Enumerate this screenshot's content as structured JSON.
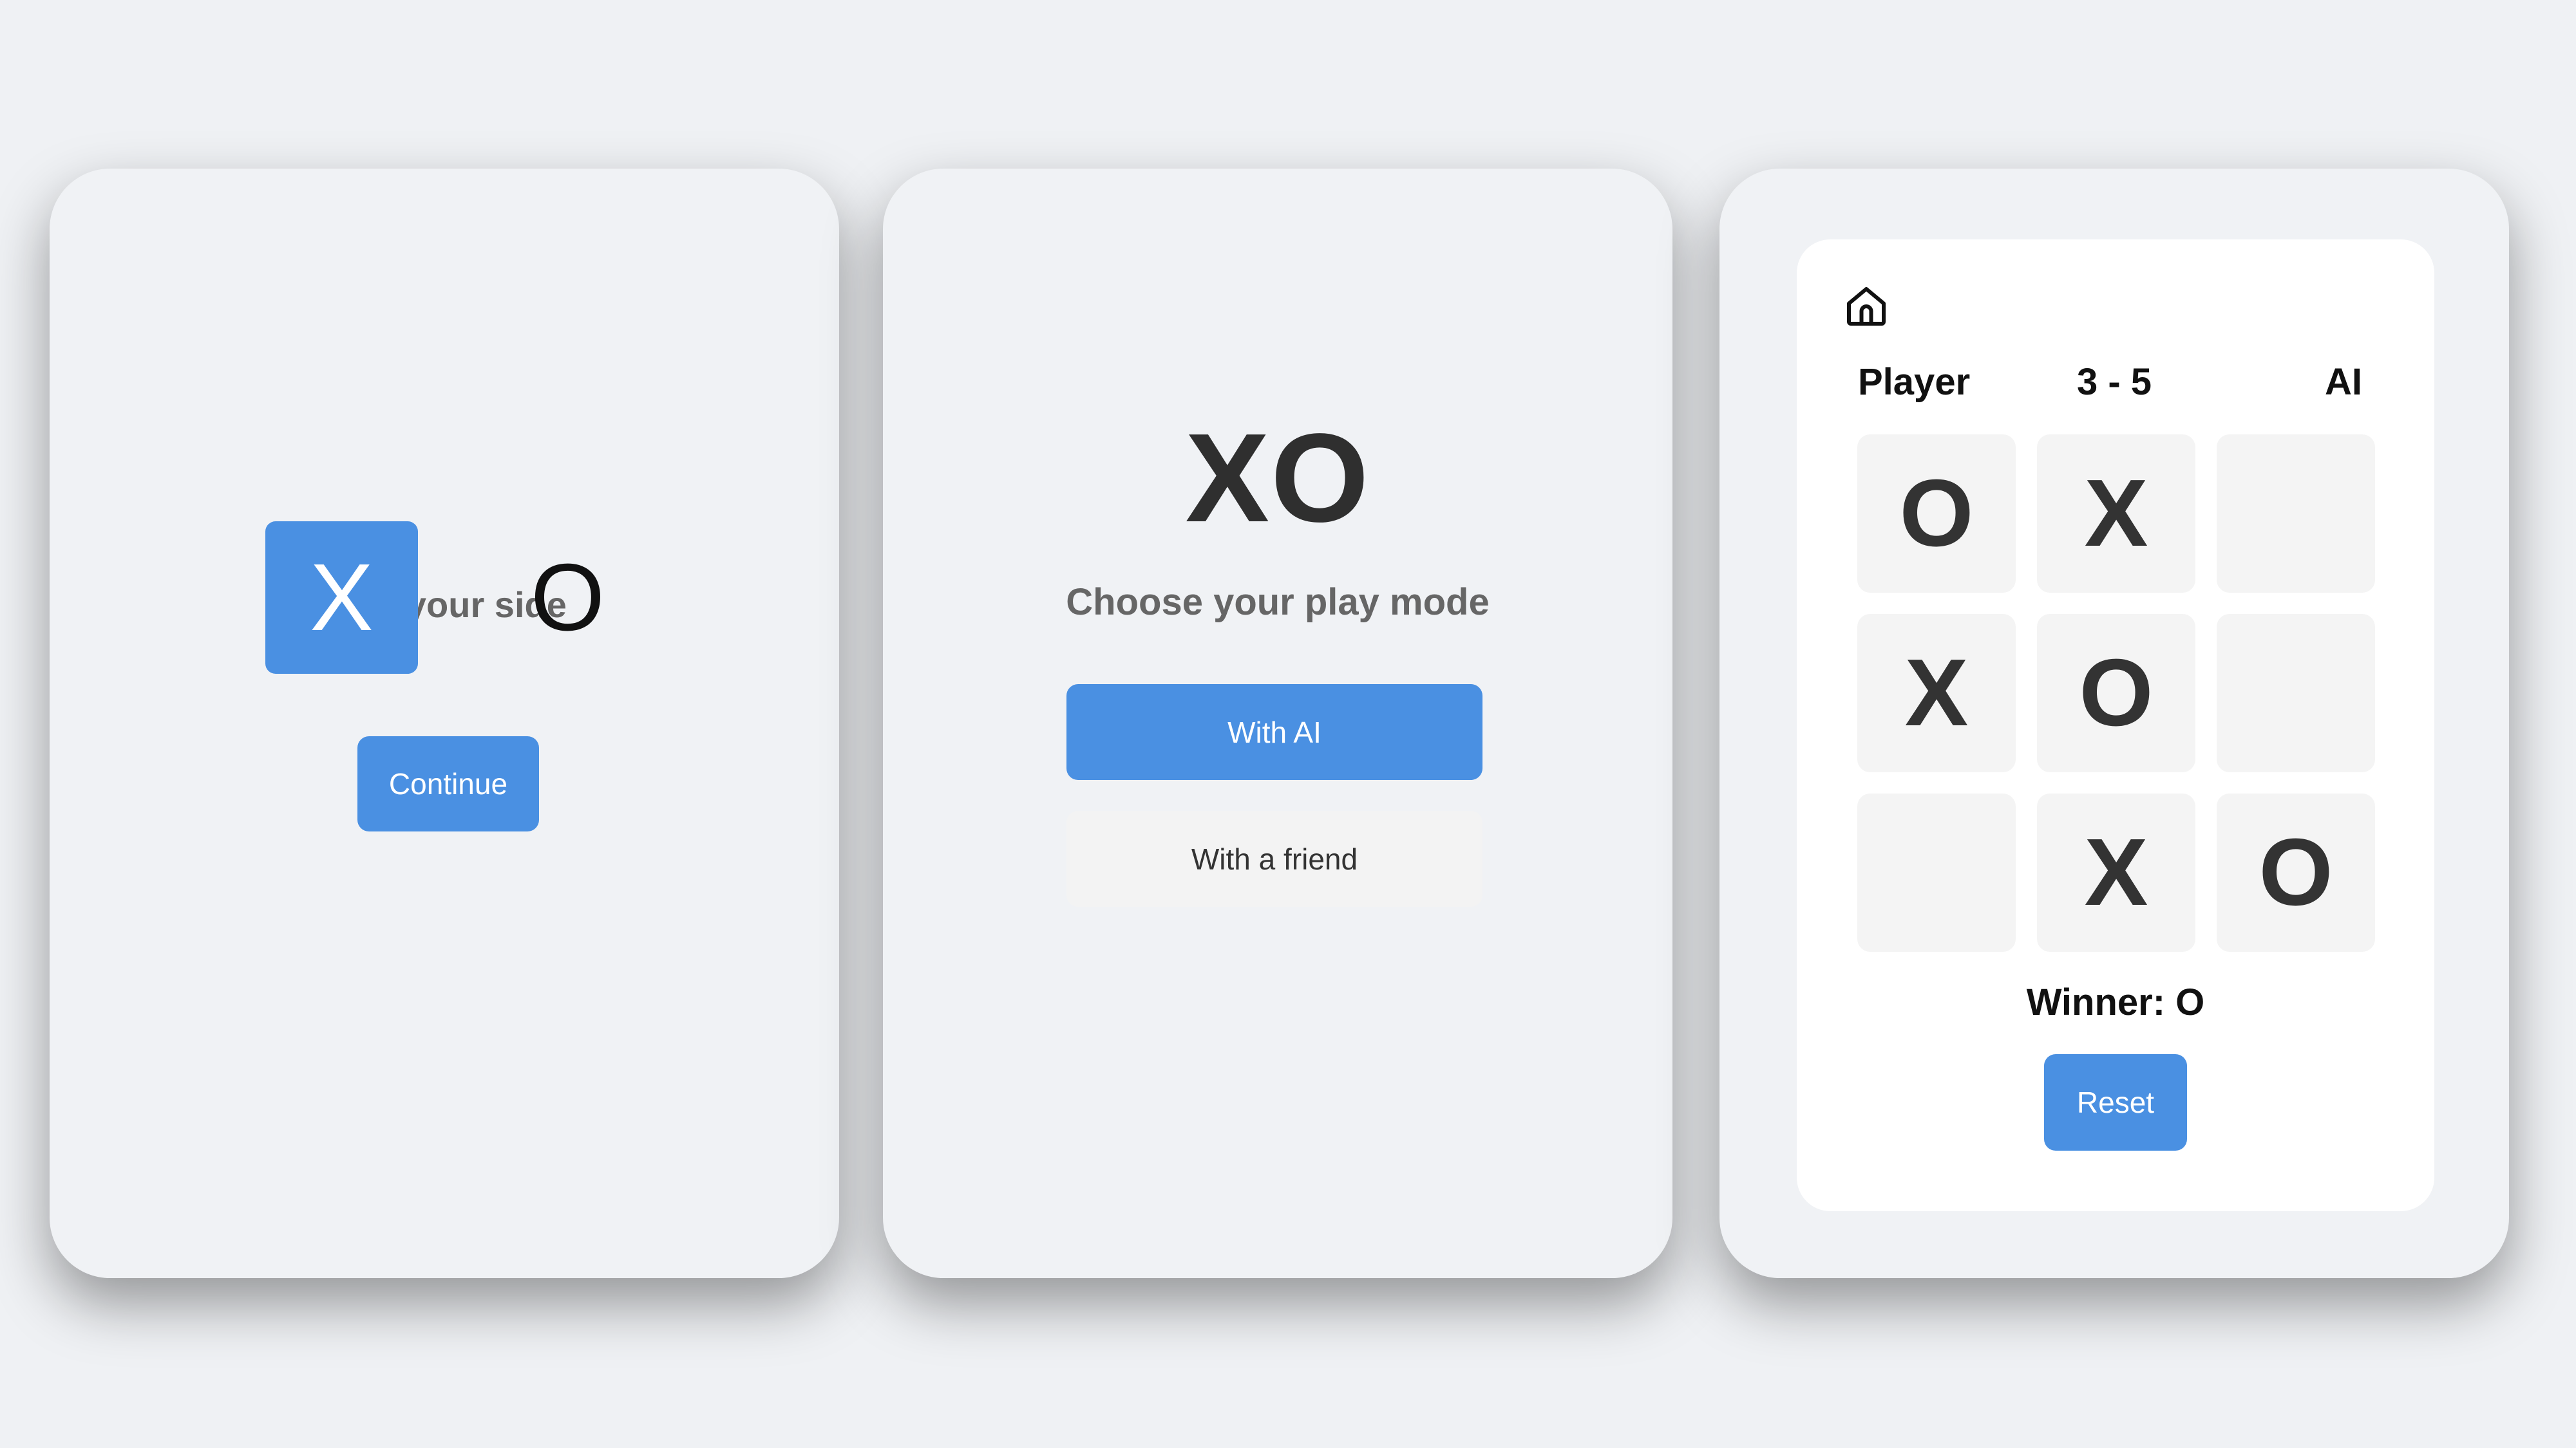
{
  "side_picker": {
    "title": "Pick your side",
    "options": [
      {
        "symbol": "X",
        "selected": true
      },
      {
        "symbol": "O",
        "selected": false
      }
    ],
    "continue_label": "Continue"
  },
  "mode_picker": {
    "logo": "XO",
    "subtitle": "Choose your play mode",
    "ai_label": "With AI",
    "friend_label": "With a friend"
  },
  "game": {
    "home_icon": "home-icon",
    "player_label": "Player",
    "score": "3 - 5",
    "opponent_label": "AI",
    "board": [
      "O",
      "X",
      "",
      "X",
      "O",
      "",
      "",
      "X",
      "O"
    ],
    "winner_text": "Winner: O",
    "reset_label": "Reset"
  },
  "colors": {
    "accent": "#4a90e2",
    "background": "#eff1f4",
    "cell": "#f4f4f4"
  }
}
